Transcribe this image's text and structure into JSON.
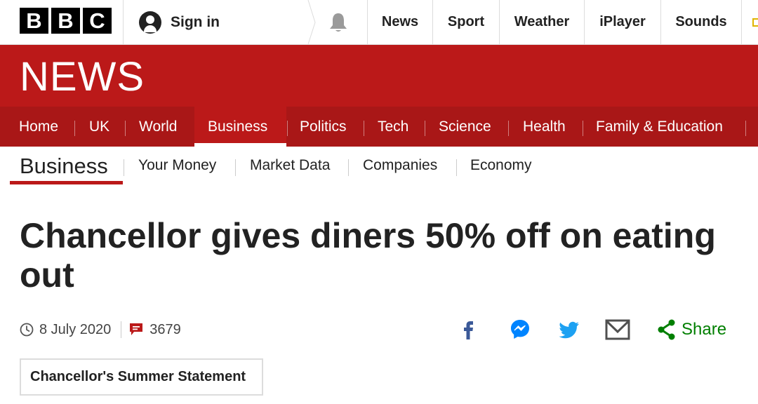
{
  "brand": {
    "letters": [
      "B",
      "B",
      "C"
    ]
  },
  "account": {
    "signin_label": "Sign in"
  },
  "top_nav": [
    "News",
    "Sport",
    "Weather",
    "iPlayer",
    "Sounds"
  ],
  "banner": {
    "title": "NEWS"
  },
  "main_nav": {
    "items": [
      "Home",
      "UK",
      "World",
      "Business",
      "Politics",
      "Tech",
      "Science",
      "Health",
      "Family & Education"
    ],
    "active": "Business"
  },
  "section": {
    "title": "Business",
    "links": [
      "Your Money",
      "Market Data",
      "Companies",
      "Economy"
    ]
  },
  "article": {
    "headline": "Chancellor gives diners 50% off on eating out",
    "date": "8 July 2020",
    "comment_count": "3679",
    "tag": "Chancellor's Summer Statement"
  },
  "share": {
    "label": "Share",
    "icons": [
      "facebook-icon",
      "messenger-icon",
      "twitter-icon",
      "email-icon",
      "share-icon"
    ]
  },
  "colors": {
    "brand_red": "#bb1919",
    "nav_red": "#a91717",
    "share_green": "#007f00",
    "facebook": "#3b5998",
    "messenger": "#0084ff",
    "twitter": "#1da1f2"
  }
}
